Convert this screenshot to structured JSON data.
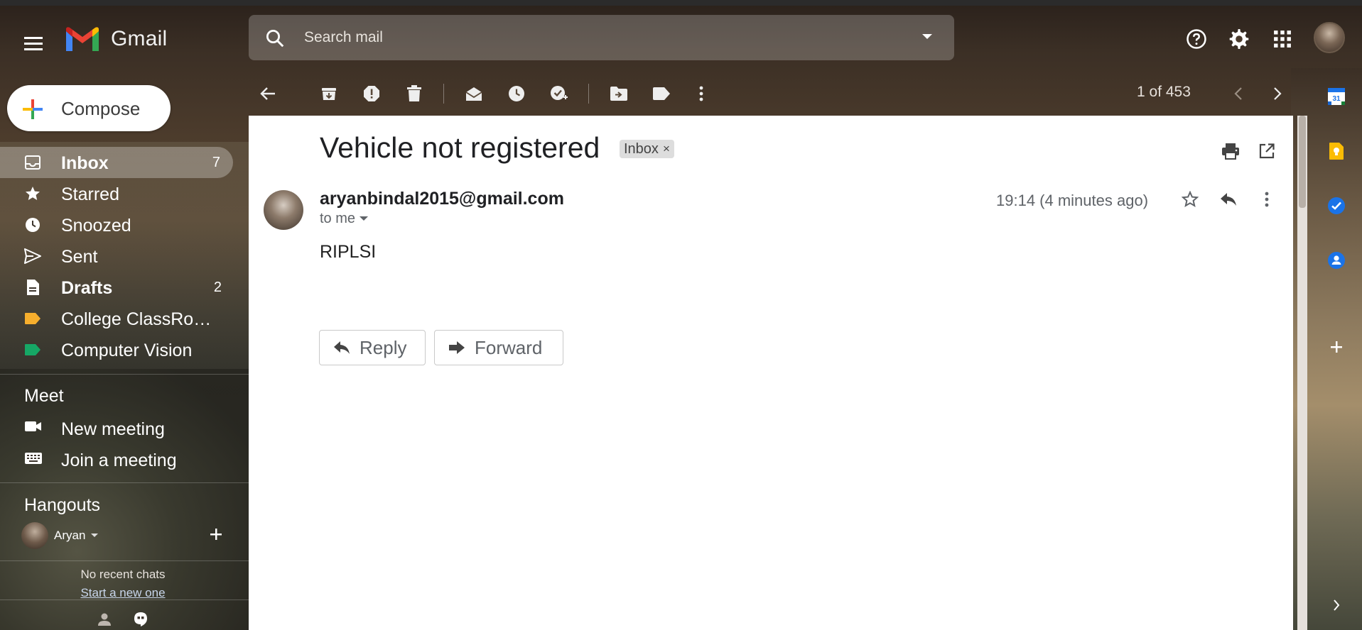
{
  "app": {
    "name": "Gmail"
  },
  "search": {
    "placeholder": "Search mail"
  },
  "compose": {
    "label": "Compose"
  },
  "sidebar": {
    "items": [
      {
        "label": "Inbox",
        "count": "7",
        "icon": "inbox-icon"
      },
      {
        "label": "Starred",
        "count": "",
        "icon": "star-icon"
      },
      {
        "label": "Snoozed",
        "count": "",
        "icon": "clock-icon"
      },
      {
        "label": "Sent",
        "count": "",
        "icon": "send-icon"
      },
      {
        "label": "Drafts",
        "count": "2",
        "icon": "draft-icon"
      },
      {
        "label": "College ClassRo…",
        "count": "",
        "icon": "label-icon",
        "color": "#f6ae2d"
      },
      {
        "label": "Computer Vision",
        "count": "",
        "icon": "label-icon",
        "color": "#16a765"
      }
    ]
  },
  "meet": {
    "title": "Meet",
    "new_meeting": "New meeting",
    "join_meeting": "Join a meeting"
  },
  "hangouts": {
    "title": "Hangouts",
    "user": "Aryan",
    "no_chats": "No recent chats",
    "start_new": "Start a new one"
  },
  "toolbar": {
    "pager": "1 of 453"
  },
  "message": {
    "subject": "Vehicle not registered",
    "label": "Inbox",
    "label_close": "×",
    "sender": "aryanbindal2015@gmail.com",
    "to": "to me",
    "time": "19:14 (4 minutes ago)",
    "body": "RIPLSI"
  },
  "actions": {
    "reply": "Reply",
    "forward": "Forward"
  },
  "colors": {
    "accent_blue": "#1a73e8",
    "gmail_red": "#ea4335",
    "label_orange": "#f6ae2d",
    "label_green": "#16a765"
  }
}
